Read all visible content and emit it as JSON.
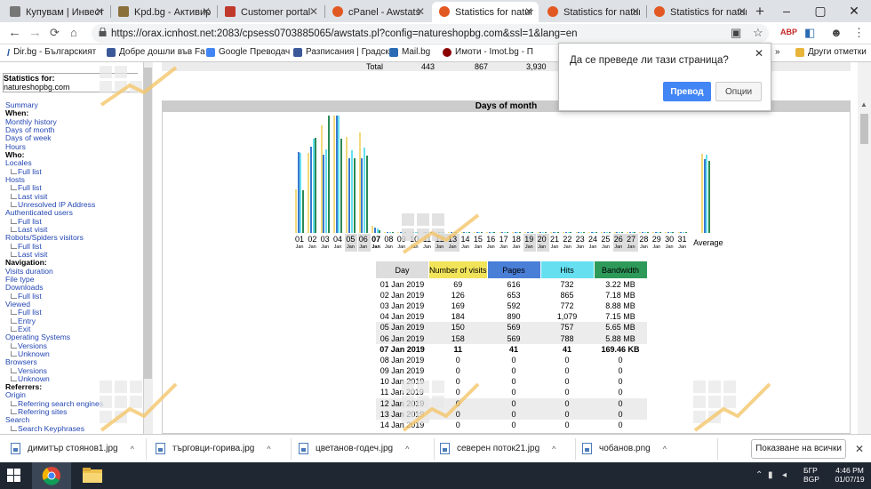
{
  "browser": {
    "tabs": [
      {
        "label": "Купувам | Инвести",
        "favicon": "site-icon",
        "color": "#777"
      },
      {
        "label": "Kpd.bg - Активира",
        "favicon": "image-icon",
        "color": "#8a6f3a"
      },
      {
        "label": "Customer portal",
        "favicon": "portal-icon",
        "color": "#c0392b"
      },
      {
        "label": "cPanel - Awstats",
        "favicon": "cpanel-icon",
        "color": "#e25822"
      },
      {
        "label": "Statistics for nature",
        "favicon": "cpanel-icon",
        "color": "#e25822"
      },
      {
        "label": "Statistics for nature",
        "favicon": "cpanel-icon",
        "color": "#e25822"
      },
      {
        "label": "Statistics for nature",
        "favicon": "cpanel-icon",
        "color": "#e25822"
      }
    ],
    "new_tab": "+",
    "url": "https://orax.icnhost.net:2083/cpsess0703885065/awstats.pl?config=natureshopbg.com&ssl=1&lang=en",
    "bookmarks": [
      {
        "label": "Dir.bg - Българският",
        "color": "#1a4fa0"
      },
      {
        "label": "Добре дошли във Fa",
        "color": "#3b5998"
      },
      {
        "label": "Google Преводач",
        "color": "#4285f4"
      },
      {
        "label": "Разписания | Градск",
        "color": "#3b5998"
      },
      {
        "label": "Mail.bg",
        "color": "#2a6ab3"
      },
      {
        "label": "Имоти - Imot.bg - П",
        "color": "#8b0000"
      },
      {
        "label": "Други отметки",
        "color": "#e8b53a"
      }
    ],
    "more_bookmarks": "»"
  },
  "translate_popup": {
    "title": "Да се преведе ли тази страница?",
    "translate_label": "Превод",
    "options_label": "Опции"
  },
  "sidebar": {
    "title": "Statistics for:",
    "site": "natureshopbg.com",
    "items": [
      {
        "t": "Summary",
        "k": "link"
      },
      {
        "t": "When:",
        "k": "head"
      },
      {
        "t": "Monthly history",
        "k": "link"
      },
      {
        "t": "Days of month",
        "k": "link"
      },
      {
        "t": "Days of week",
        "k": "link"
      },
      {
        "t": "Hours",
        "k": "link"
      },
      {
        "t": "Who:",
        "k": "head"
      },
      {
        "t": "Locales",
        "k": "link"
      },
      {
        "t": "Full list",
        "k": "sub"
      },
      {
        "t": "Hosts",
        "k": "link"
      },
      {
        "t": "Full list",
        "k": "sub"
      },
      {
        "t": "Last visit",
        "k": "sub"
      },
      {
        "t": "Unresolved IP Address",
        "k": "sub"
      },
      {
        "t": "Authenticated users",
        "k": "link"
      },
      {
        "t": "Full list",
        "k": "sub"
      },
      {
        "t": "Last visit",
        "k": "sub"
      },
      {
        "t": "Robots/Spiders visitors",
        "k": "link"
      },
      {
        "t": "Full list",
        "k": "sub"
      },
      {
        "t": "Last visit",
        "k": "sub"
      },
      {
        "t": "Navigation:",
        "k": "head"
      },
      {
        "t": "Visits duration",
        "k": "link"
      },
      {
        "t": "File type",
        "k": "link"
      },
      {
        "t": "Downloads",
        "k": "link"
      },
      {
        "t": "Full list",
        "k": "sub"
      },
      {
        "t": "Viewed",
        "k": "link"
      },
      {
        "t": "Full list",
        "k": "sub"
      },
      {
        "t": "Entry",
        "k": "sub"
      },
      {
        "t": "Exit",
        "k": "sub"
      },
      {
        "t": "Operating Systems",
        "k": "link"
      },
      {
        "t": "Versions",
        "k": "sub"
      },
      {
        "t": "Unknown",
        "k": "sub"
      },
      {
        "t": "Browsers",
        "k": "link"
      },
      {
        "t": "Versions",
        "k": "sub"
      },
      {
        "t": "Unknown",
        "k": "sub"
      },
      {
        "t": "Referrers:",
        "k": "head"
      },
      {
        "t": "Origin",
        "k": "link"
      },
      {
        "t": "Referring search engines",
        "k": "sub"
      },
      {
        "t": "Referring sites",
        "k": "sub"
      },
      {
        "t": "Search",
        "k": "link"
      },
      {
        "t": "Search Keyphrases",
        "k": "sub"
      }
    ]
  },
  "summary_total": {
    "label": "Total",
    "visits": "443",
    "pages": "867",
    "hits": "3,930"
  },
  "days_of_month": {
    "heading": "Days of month",
    "average_label": "Average",
    "colors": {
      "visits": "#f2d97a",
      "pages": "#3a78d0",
      "hits": "#66e0f0",
      "bandwidth": "#2a8a55"
    },
    "columns": [
      "Day",
      "Number of visits",
      "Pages",
      "Hits",
      "Bandwidth"
    ],
    "rows": [
      {
        "day": "01 Jan 2019",
        "visits": "69",
        "pages": "616",
        "hits": "732",
        "bw": "3.22 MB"
      },
      {
        "day": "02 Jan 2019",
        "visits": "126",
        "pages": "653",
        "hits": "865",
        "bw": "7.18 MB"
      },
      {
        "day": "03 Jan 2019",
        "visits": "169",
        "pages": "592",
        "hits": "772",
        "bw": "8.88 MB"
      },
      {
        "day": "04 Jan 2019",
        "visits": "184",
        "pages": "890",
        "hits": "1,079",
        "bw": "7.15 MB"
      },
      {
        "day": "05 Jan 2019",
        "visits": "150",
        "pages": "569",
        "hits": "757",
        "bw": "5.65 MB"
      },
      {
        "day": "06 Jan 2019",
        "visits": "158",
        "pages": "569",
        "hits": "788",
        "bw": "5.88 MB"
      },
      {
        "day": "07 Jan 2019",
        "visits": "11",
        "pages": "41",
        "hits": "41",
        "bw": "169.46 KB"
      },
      {
        "day": "08 Jan 2019",
        "visits": "0",
        "pages": "0",
        "hits": "0",
        "bw": "0"
      },
      {
        "day": "09 Jan 2019",
        "visits": "0",
        "pages": "0",
        "hits": "0",
        "bw": "0"
      },
      {
        "day": "10 Jan 2019",
        "visits": "0",
        "pages": "0",
        "hits": "0",
        "bw": "0"
      },
      {
        "day": "11 Jan 2019",
        "visits": "0",
        "pages": "0",
        "hits": "0",
        "bw": "0"
      },
      {
        "day": "12 Jan 2019",
        "visits": "0",
        "pages": "0",
        "hits": "0",
        "bw": "0"
      },
      {
        "day": "13 Jan 2019",
        "visits": "0",
        "pages": "0",
        "hits": "0",
        "bw": "0"
      },
      {
        "day": "14 Jan 2019",
        "visits": "0",
        "pages": "0",
        "hits": "0",
        "bw": "0"
      }
    ],
    "chart_days": [
      "01",
      "02",
      "03",
      "04",
      "05",
      "06",
      "07",
      "08",
      "09",
      "10",
      "11",
      "12",
      "13",
      "14",
      "15",
      "16",
      "17",
      "18",
      "19",
      "20",
      "21",
      "22",
      "23",
      "24",
      "25",
      "26",
      "27",
      "28",
      "29",
      "30",
      "31"
    ],
    "chart_month": "Jan",
    "weekend_days": [
      "05",
      "06",
      "12",
      "13",
      "19",
      "20",
      "26",
      "27"
    ],
    "today_day": "07"
  },
  "chart_data": {
    "type": "bar",
    "categories": [
      "01",
      "02",
      "03",
      "04",
      "05",
      "06",
      "07",
      "08",
      "09",
      "10",
      "11",
      "12",
      "13",
      "14",
      "15",
      "16",
      "17",
      "18",
      "19",
      "20",
      "21",
      "22",
      "23",
      "24",
      "25",
      "26",
      "27",
      "28",
      "29",
      "30",
      "31",
      "Average"
    ],
    "series": [
      {
        "name": "Number of visits",
        "values": [
          69,
          126,
          169,
          184,
          150,
          158,
          11,
          0,
          0,
          0,
          0,
          0,
          0,
          0,
          0,
          0,
          0,
          0,
          0,
          0,
          0,
          0,
          0,
          0,
          0,
          0,
          0,
          0,
          0,
          0,
          0,
          124
        ]
      },
      {
        "name": "Pages",
        "values": [
          616,
          653,
          592,
          890,
          569,
          569,
          41,
          0,
          0,
          0,
          0,
          0,
          0,
          0,
          0,
          0,
          0,
          0,
          0,
          0,
          0,
          0,
          0,
          0,
          0,
          0,
          0,
          0,
          0,
          0,
          0,
          561
        ]
      },
      {
        "name": "Hits",
        "values": [
          732,
          865,
          772,
          1079,
          757,
          788,
          41,
          0,
          0,
          0,
          0,
          0,
          0,
          0,
          0,
          0,
          0,
          0,
          0,
          0,
          0,
          0,
          0,
          0,
          0,
          0,
          0,
          0,
          0,
          0,
          0,
          719
        ]
      },
      {
        "name": "Bandwidth",
        "values": [
          3.22,
          7.18,
          8.88,
          7.15,
          5.65,
          5.88,
          0.17,
          0,
          0,
          0,
          0,
          0,
          0,
          0,
          0,
          0,
          0,
          0,
          0,
          0,
          0,
          0,
          0,
          0,
          0,
          0,
          0,
          0,
          0,
          0,
          0,
          5.45
        ]
      }
    ]
  },
  "downloads": {
    "files": [
      {
        "name": "димитър стоянов1.jpg"
      },
      {
        "name": "търговци-горива.jpg"
      },
      {
        "name": "цветанов-годеч.jpg"
      },
      {
        "name": "северен поток21.jpg"
      },
      {
        "name": "чобанов.png"
      }
    ],
    "show_all": "Показване на всички",
    "chevron": "^"
  },
  "taskbar": {
    "lang_1": "БГР",
    "lang_2": "BGP",
    "time": "4:46 PM",
    "date": "01/07/19"
  }
}
